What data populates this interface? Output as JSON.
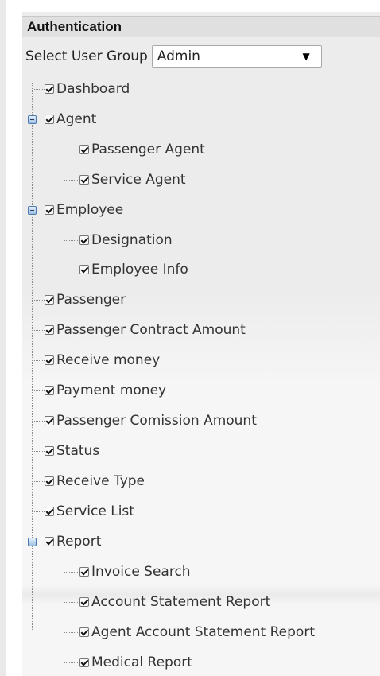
{
  "panel": {
    "title": "Authentication"
  },
  "group_select": {
    "label": "Select User Group",
    "value": "Admin"
  },
  "tree": {
    "dashboard": "Dashboard",
    "agent": {
      "label": "Agent",
      "children": [
        "Passenger Agent",
        "Service Agent"
      ]
    },
    "employee": {
      "label": "Employee",
      "children": [
        "Designation",
        "Employee Info"
      ]
    },
    "items": [
      "Passenger",
      "Passenger Contract Amount",
      "Receive money",
      "Payment money",
      "Passenger Comission Amount",
      "Status",
      "Receive Type",
      "Service List"
    ],
    "report": {
      "label": "Report",
      "children": [
        "Invoice Search",
        "Account Statement Report",
        "Agent Account Statement Report",
        "Medical Report"
      ]
    }
  }
}
